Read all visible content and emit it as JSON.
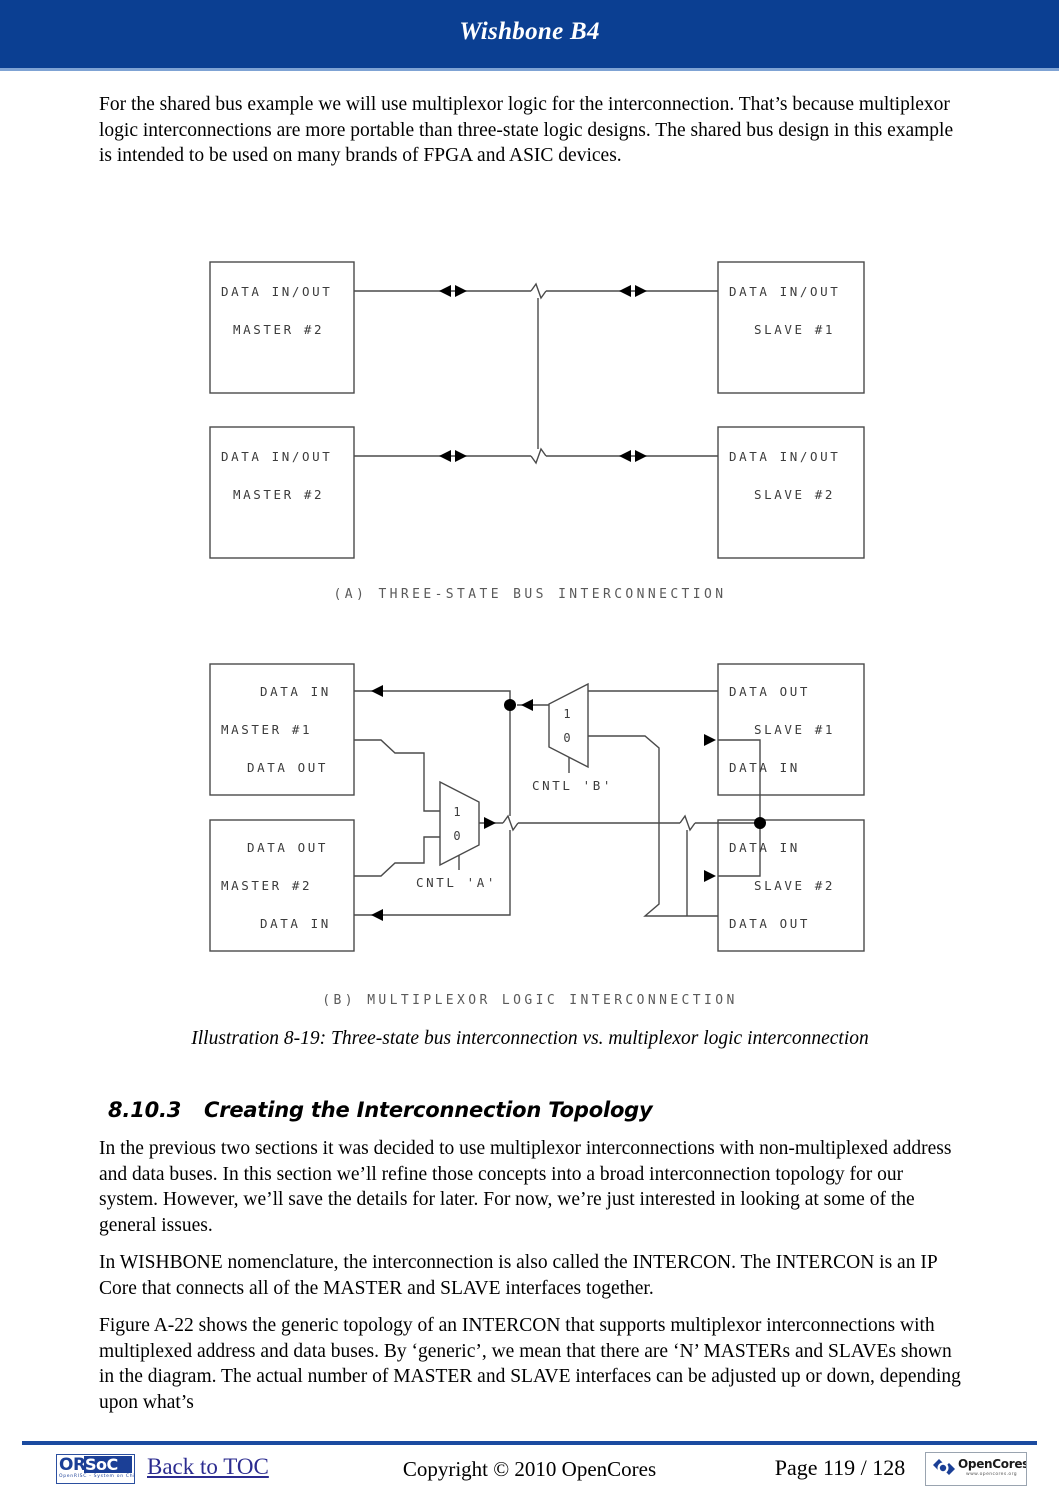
{
  "header": {
    "title": "Wishbone B4"
  },
  "paragraphs": {
    "intro": "For the shared bus example we will use multiplexor logic for the interconnection.  That’s because multiplexor logic interconnections are more portable than three-state logic designs.  The shared bus design in this example is intended to be used on many brands of FPGA and ASIC devices.",
    "p1": "In the previous two sections it was decided to use multiplexor interconnections with non-multiplexed address and data buses.  In this section we’ll refine those concepts into a broad interconnection topology for our system.  However, we’ll save the details for later.  For now, we’re just interested in looking at some of the general issues.",
    "p2": "In WISHBONE nomenclature, the interconnection is also called the INTERCON.  The INTERCON is an IP Core that connects all of the MASTER and SLAVE interfaces  together.",
    "p3": "Figure A-22 shows the generic topology of an INTERCON that supports multiplexor interconnections with multiplexed address and data buses.  By ‘generic’, we mean that there are ‘N’ MASTERs and SLAVEs shown in the diagram.  The actual number of MASTER and SLAVE interfaces can be adjusted up or down, depending upon what’s"
  },
  "illustration": {
    "caption": "Illustration 8-19: Three-state bus interconnection vs. multiplexor logic interconnection",
    "diagram_a": {
      "caption": "(A) THREE-STATE BUS INTERCONNECTION",
      "blocks": [
        {
          "line1": "DATA IN/OUT",
          "line2": "MASTER #2"
        },
        {
          "line1": "DATA IN/OUT",
          "line2": "MASTER #2"
        },
        {
          "line1": "DATA IN/OUT",
          "line2": "SLAVE #1"
        },
        {
          "line1": "DATA IN/OUT",
          "line2": "SLAVE #2"
        }
      ]
    },
    "diagram_b": {
      "caption": "(B) MULTIPLEXOR LOGIC INTERCONNECTION",
      "master1": {
        "l1": "DATA IN",
        "l2": "MASTER #1",
        "l3": "DATA OUT"
      },
      "master2": {
        "l1": "DATA OUT",
        "l2": "MASTER #2",
        "l3": "DATA IN"
      },
      "slave1": {
        "l1": "DATA OUT",
        "l2": "SLAVE #1",
        "l3": "DATA IN"
      },
      "slave2": {
        "l1": "DATA IN",
        "l2": "SLAVE #2",
        "l3": "DATA OUT"
      },
      "mux_a": {
        "label": "CNTL 'A'",
        "in1": "1",
        "in0": "0"
      },
      "mux_b": {
        "label": "CNTL 'B'",
        "in1": "1",
        "in0": "0"
      }
    }
  },
  "section": {
    "number": "8.10.3",
    "title": "Creating the Interconnection Topology"
  },
  "footer": {
    "orsoc_or": "OR",
    "orsoc_soc": "SoC",
    "orsoc_tagline": "OpenRISC  -   System on Chip",
    "toc_link": "Back to TOC",
    "copyright": "Copyright © 2010 OpenCores",
    "page": "Page 119 / 128",
    "opencores_name": "OpenCores",
    "opencores_url": "www.opencores.org"
  },
  "colors": {
    "header_blue": "#0b3f92",
    "footer_rule": "#1b4ba0",
    "link_blue": "#2b2b8f",
    "diagram_stroke": "#4a4a4a"
  }
}
